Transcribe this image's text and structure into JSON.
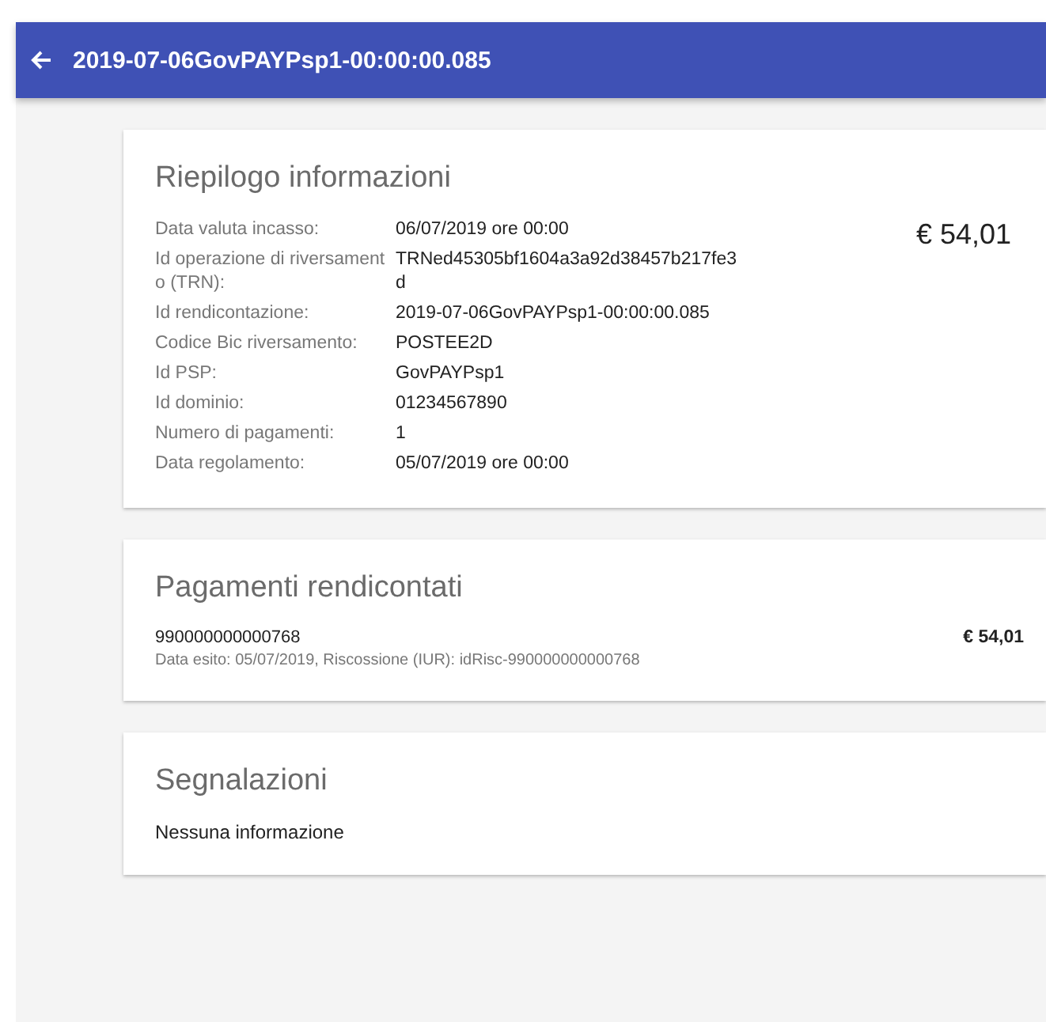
{
  "header": {
    "title": "2019-07-06GovPAYPsp1-00:00:00.085"
  },
  "summary": {
    "title": "Riepilogo informazioni",
    "amount": "€ 54,01",
    "fields": [
      {
        "label": "Data valuta incasso:",
        "value": "06/07/2019 ore 00:00"
      },
      {
        "label": "Id operazione di riversamento (TRN):",
        "value": "TRNed45305bf1604a3a92d38457b217fe3d"
      },
      {
        "label": "Id rendicontazione:",
        "value": "2019-07-06GovPAYPsp1-00:00:00.085"
      },
      {
        "label": "Codice Bic riversamento:",
        "value": "POSTEE2D"
      },
      {
        "label": "Id PSP:",
        "value": "GovPAYPsp1"
      },
      {
        "label": "Id dominio:",
        "value": "01234567890"
      },
      {
        "label": "Numero di pagamenti:",
        "value": "1"
      },
      {
        "label": "Data regolamento:",
        "value": "05/07/2019 ore 00:00"
      }
    ]
  },
  "payments": {
    "title": "Pagamenti rendicontati",
    "items": [
      {
        "code": "990000000000768",
        "detail": "Data esito: 05/07/2019, Riscossione (IUR): idRisc-990000000000768",
        "amount": "€ 54,01"
      }
    ]
  },
  "reports": {
    "title": "Segnalazioni",
    "message": "Nessuna informazione"
  }
}
